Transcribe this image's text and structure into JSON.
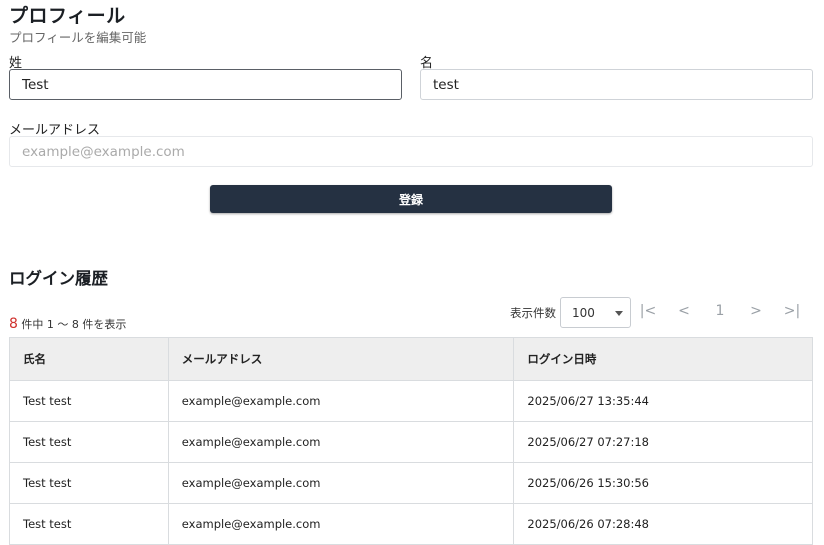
{
  "profile": {
    "title": "プロフィール",
    "subtitle": "プロフィールを編集可能",
    "last_name_label": "姓",
    "last_name_value": "Test",
    "first_name_label": "名",
    "first_name_value": "test",
    "email_label": "メールアドレス",
    "email_placeholder": "example@example.com",
    "submit_label": "登録"
  },
  "history": {
    "title": "ログイン履歴",
    "total": "8",
    "count_text": "件中 1 〜 8 件を表示",
    "per_page_label": "表示件数",
    "per_page_value": "100",
    "pagination": {
      "first": "|<",
      "prev": "<",
      "page": "1",
      "next": ">",
      "last": ">|"
    },
    "columns": [
      "氏名",
      "メールアドレス",
      "ログイン日時"
    ],
    "rows": [
      {
        "name": "Test test",
        "email": "example@example.com",
        "datetime": "2025/06/27 13:35:44"
      },
      {
        "name": "Test test",
        "email": "example@example.com",
        "datetime": "2025/06/27 07:27:18"
      },
      {
        "name": "Test test",
        "email": "example@example.com",
        "datetime": "2025/06/26 15:30:56"
      },
      {
        "name": "Test test",
        "email": "example@example.com",
        "datetime": "2025/06/26 07:28:48"
      }
    ]
  }
}
